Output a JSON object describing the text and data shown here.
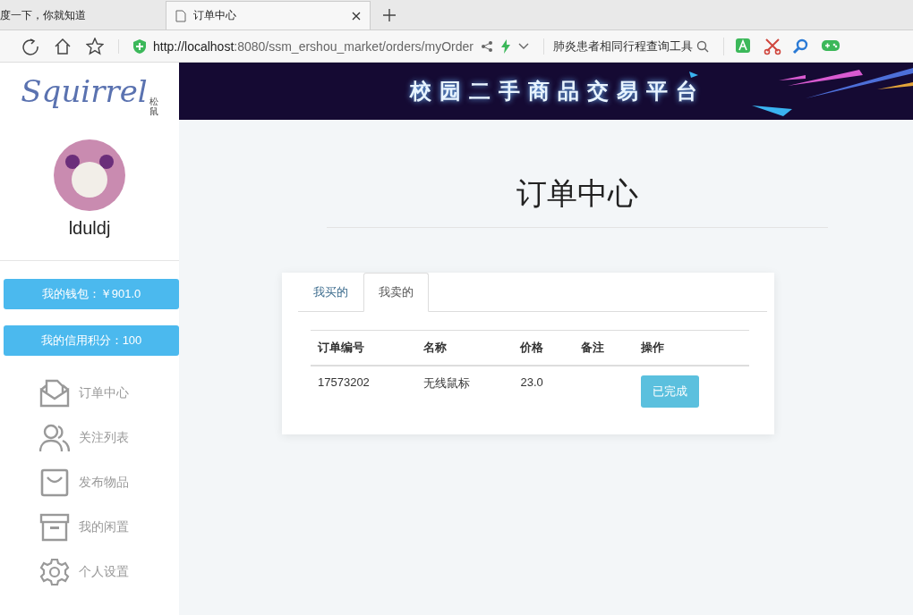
{
  "browser": {
    "tabs": [
      {
        "title": "度一下，你就知道",
        "selected": false
      },
      {
        "title": "订单中心",
        "selected": true
      }
    ],
    "url_host": "http://localhost",
    "url_rest": ":8080/ssm_ershou_market/orders/myOrder",
    "search_text": "肺炎患者相同行程查询工具"
  },
  "logo": {
    "text": "Squirrel",
    "subtext": "松鼠"
  },
  "banner": {
    "title": "校园二手商品交易平台"
  },
  "user": {
    "name": "lduldj"
  },
  "wallet_buttons": [
    "我的钱包：￥901.0",
    "我的信用积分：100"
  ],
  "menu": [
    {
      "kind": "envelope",
      "label": "订单中心"
    },
    {
      "kind": "users",
      "label": "关注列表"
    },
    {
      "kind": "bag",
      "label": "发布物品"
    },
    {
      "kind": "box",
      "label": "我的闲置"
    },
    {
      "kind": "gear",
      "label": "个人设置"
    }
  ],
  "page_title": "订单中心",
  "order_tabs": [
    {
      "label": "我买的",
      "selected": false
    },
    {
      "label": "我卖的",
      "selected": true
    }
  ],
  "table": {
    "columns": [
      "订单编号",
      "名称",
      "价格",
      "备注",
      "操作"
    ],
    "rows": [
      {
        "cells": [
          "17573202",
          "无线鼠标",
          "23.0"
        ],
        "action": "已完成"
      }
    ]
  }
}
